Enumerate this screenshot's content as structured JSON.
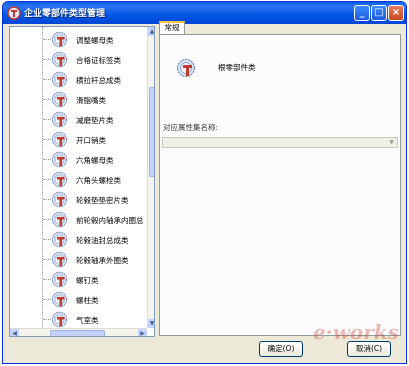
{
  "window": {
    "title": "企业零部件类型管理",
    "icon": "app-gear-icon",
    "controls": [
      "minimize",
      "maximize",
      "close"
    ]
  },
  "tree": {
    "icon": "gear-t-icon",
    "items": [
      {
        "label": "调整螺母类"
      },
      {
        "label": "合格证标签类"
      },
      {
        "label": "横拉杆总成类"
      },
      {
        "label": "滑脂嘴类"
      },
      {
        "label": "减磨垫片类"
      },
      {
        "label": "开口销类"
      },
      {
        "label": "六角螺母类"
      },
      {
        "label": "六角头螺栓类"
      },
      {
        "label": "轮毂垫垫密片类"
      },
      {
        "label": "前轮毂内轴承内圈总"
      },
      {
        "label": "轮毂油封总成类"
      },
      {
        "label": "轮毂轴承外圈类"
      },
      {
        "label": "螺钉类"
      },
      {
        "label": "螺柱类"
      },
      {
        "label": "气室类"
      }
    ]
  },
  "tabs": [
    {
      "label": "常规"
    }
  ],
  "detail": {
    "icon": "gear-t-icon",
    "name": "根零部件类",
    "field_label": "对应属性集名称:",
    "field_value": ""
  },
  "buttons": {
    "ok": "确定(O)",
    "cancel": "取消(C)"
  },
  "watermark": "e-works"
}
